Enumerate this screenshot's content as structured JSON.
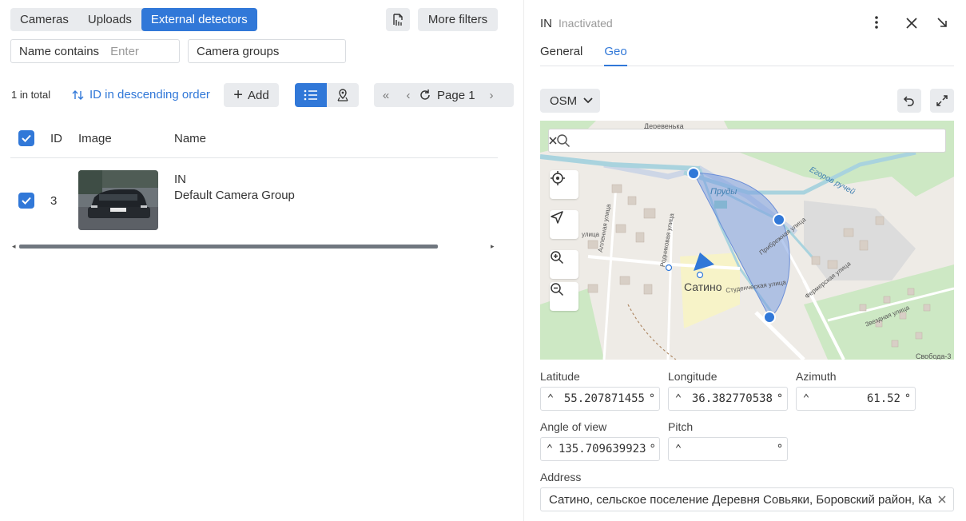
{
  "source_tabs": {
    "cameras": "Cameras",
    "uploads": "Uploads",
    "external": "External detectors"
  },
  "toolbar": {
    "more_filters": "More filters",
    "add": "Add"
  },
  "filters": {
    "name_label": "Name contains",
    "name_placeholder": "Enter",
    "groups_label": "Camera groups"
  },
  "list": {
    "total": "1 in total",
    "order": "ID in descending order",
    "page": "Page 1",
    "columns": {
      "id": "ID",
      "image": "Image",
      "name": "Name"
    },
    "rows": [
      {
        "id": "3",
        "name": "IN",
        "group": "Default Camera Group"
      }
    ]
  },
  "detail": {
    "title": "IN",
    "status": "Inactivated",
    "tabs": {
      "general": "General",
      "geo": "Geo"
    }
  },
  "geo": {
    "map_source": "OSM",
    "map_labels": {
      "pond": "Пруды",
      "village": "Сатино",
      "stream": "Егоров ручей",
      "street1": "Прибрежная улица",
      "street2": "Фермерская улица",
      "street3": "Звездная улица",
      "street4": "Студенческая улица",
      "street5": "Родниковая улица",
      "street6": "Алленная улица",
      "street7": "улица",
      "top": "Деревенька",
      "bottom": "Свобода-3"
    },
    "latitude_label": "Latitude",
    "latitude": "55.207871455",
    "longitude_label": "Longitude",
    "longitude": "36.382770538",
    "azimuth_label": "Azimuth",
    "azimuth": "61.52",
    "angle_label": "Angle of view",
    "angle": "135.709639923",
    "pitch_label": "Pitch",
    "pitch": "",
    "unit": "°",
    "address_label": "Address",
    "address": "Сатино, сельское поселение Деревня Совьяки, Боровский район, Ка"
  },
  "colors": {
    "accent": "#3178d8",
    "button_gray": "#e9ebee",
    "fov_fill": "#7b9ee0",
    "water": "#a9d3de",
    "forest": "#cde8c4"
  }
}
